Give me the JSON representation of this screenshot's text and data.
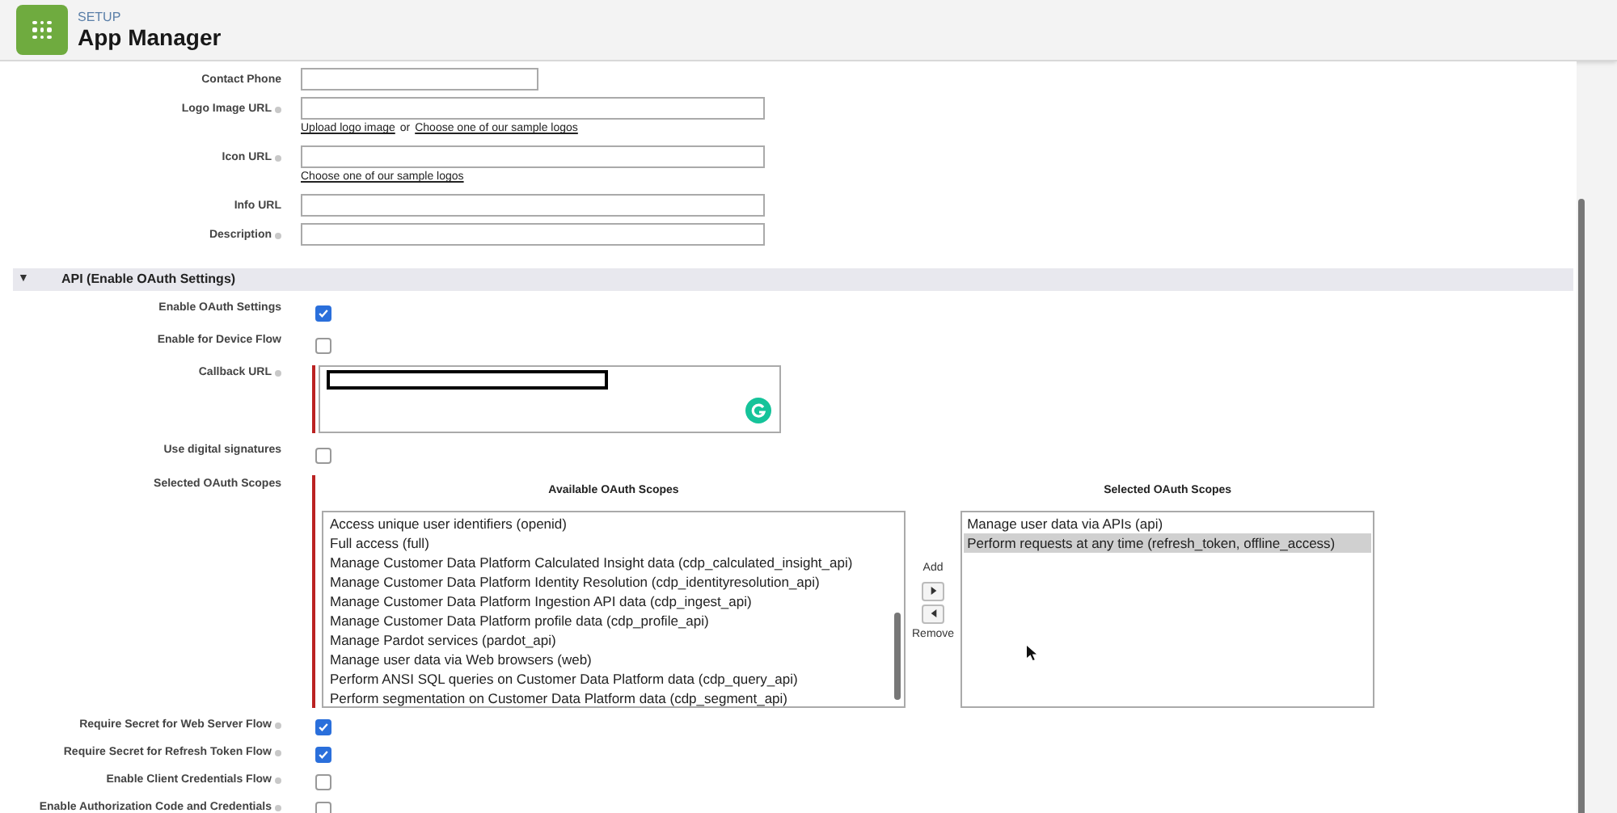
{
  "header": {
    "eyebrow": "SETUP",
    "title": "App Manager"
  },
  "basic_fields": [
    {
      "label": "Contact Phone",
      "help": false,
      "kind": "short"
    },
    {
      "label": "Logo Image URL",
      "help": true,
      "kind": "long",
      "links": [
        "Upload logo image",
        "Choose one of our sample logos"
      ],
      "link_separator": "or"
    },
    {
      "label": "Icon URL",
      "help": true,
      "kind": "long",
      "links": [
        "Choose one of our sample logos"
      ]
    },
    {
      "label": "Info URL",
      "help": false,
      "kind": "long"
    },
    {
      "label": "Description",
      "help": true,
      "kind": "long"
    }
  ],
  "section": {
    "toggle": "▼",
    "title": "API (Enable OAuth Settings)",
    "expanded": true
  },
  "oauth_top": [
    {
      "kind": "checkbox",
      "label": "Enable OAuth Settings",
      "help": false,
      "checked": true
    },
    {
      "kind": "checkbox",
      "label": "Enable for Device Flow",
      "help": false,
      "checked": false
    },
    {
      "kind": "textarea",
      "label": "Callback URL",
      "help": true,
      "required": true
    },
    {
      "kind": "checkbox",
      "label": "Use digital signatures",
      "help": false,
      "checked": false
    }
  ],
  "scopes": {
    "label": "Selected OAuth Scopes",
    "required": true,
    "available_title": "Available OAuth Scopes",
    "available": [
      {
        "text": "Access unique user identifiers (openid)",
        "selected": false
      },
      {
        "text": "Full access (full)",
        "selected": false
      },
      {
        "text": "Manage Customer Data Platform Calculated Insight data (cdp_calculated_insight_api)",
        "selected": false
      },
      {
        "text": "Manage Customer Data Platform Identity Resolution (cdp_identityresolution_api)",
        "selected": false
      },
      {
        "text": "Manage Customer Data Platform Ingestion API data (cdp_ingest_api)",
        "selected": false
      },
      {
        "text": "Manage Customer Data Platform profile data (cdp_profile_api)",
        "selected": false
      },
      {
        "text": "Manage Pardot services (pardot_api)",
        "selected": false
      },
      {
        "text": "Manage user data via Web browsers (web)",
        "selected": false
      },
      {
        "text": "Perform ANSI SQL queries on Customer Data Platform data (cdp_query_api)",
        "selected": false
      },
      {
        "text": "Perform segmentation on Customer Data Platform data (cdp_segment_api)",
        "selected": false
      }
    ],
    "add_label": "Add",
    "remove_label": "Remove",
    "selected_title": "Selected OAuth Scopes",
    "selected_list": [
      {
        "text": "Manage user data via APIs (api)",
        "selected": false
      },
      {
        "text": "Perform requests at any time (refresh_token, offline_access)",
        "selected": true
      }
    ]
  },
  "oauth_bottom": [
    {
      "label": "Require Secret for Web Server Flow",
      "help": true,
      "checked": true
    },
    {
      "label": "Require Secret for Refresh Token Flow",
      "help": true,
      "checked": true
    },
    {
      "label": "Enable Client Credentials Flow",
      "help": true,
      "checked": false
    },
    {
      "label": "Enable Authorization Code and Credentials",
      "help": true,
      "checked": false
    }
  ]
}
